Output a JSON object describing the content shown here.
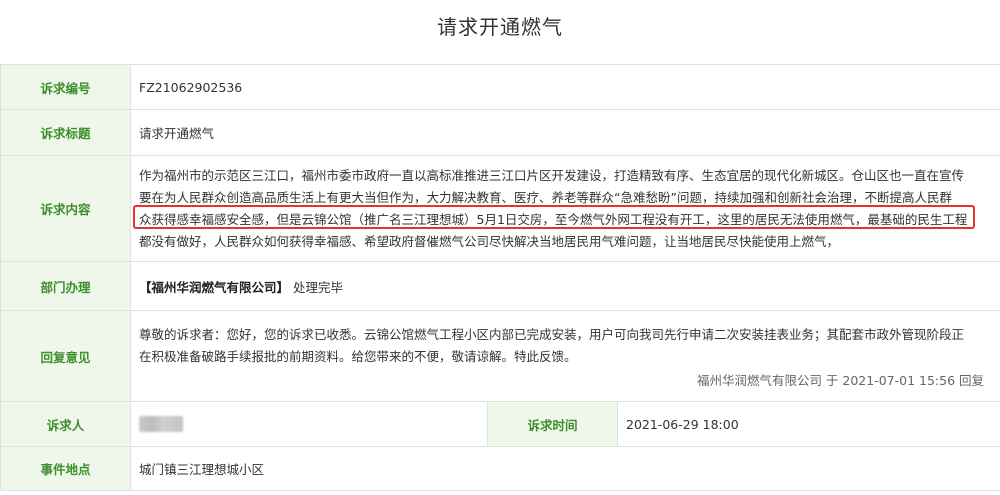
{
  "page_title": "请求开通燃气",
  "labels": {
    "petition_no": "诉求编号",
    "petition_title": "诉求标题",
    "petition_content": "诉求内容",
    "department": "部门办理",
    "reply": "回复意见",
    "petitioner": "诉求人",
    "petition_time": "诉求时间",
    "location": "事件地点"
  },
  "values": {
    "petition_no": "FZ21062902536",
    "petition_title": "请求开通燃气",
    "content_lines": [
      "作为福州市的示范区三江口，福州市委市政府一直以高标准推进三江口片区开发建设，打造精致有序、生态宜居的现代化新城区。仓山区也一直在宣传",
      "要在为人民群众创造高品质生活上有更大当但作为，大力解决教育、医疗、养老等群众“急难愁盼”问题，持续加强和创新社会治理，不断提高人民群",
      "众获得感幸福感安全感，但是云锦公馆（推广名三江理想城）5月1日交房，至今燃气外网工程没有开工，这里的居民无法使用燃气，最基础的民生工程",
      "都没有做好，人民群众如何获得幸福感、希望政府督催燃气公司尽快解决当地居民用气难问题，让当地居民尽快能使用上燃气，"
    ],
    "department_name": "【福州华润燃气有限公司】",
    "department_status": "处理完毕",
    "reply_lines": [
      "尊敬的诉求者：您好，您的诉求已收悉。云锦公馆燃气工程小区内部已完成安装，用户可向我司先行申请二次安装挂表业务；其配套市政外管现阶段正",
      "在积极准备破路手续报批的前期资料。给您带来的不便，敬请谅解。特此反馈。"
    ],
    "reply_signature": "福州华润燃气有限公司 于 2021-07-01 15:56 回复",
    "petition_time": "2021-06-29 18:00",
    "location": "城门镇三江理想城小区"
  },
  "colors": {
    "label_bg": "#eef7e9",
    "label_text": "#3e8e2d",
    "border": "#e0e0e0",
    "highlight": "#e8312f"
  }
}
